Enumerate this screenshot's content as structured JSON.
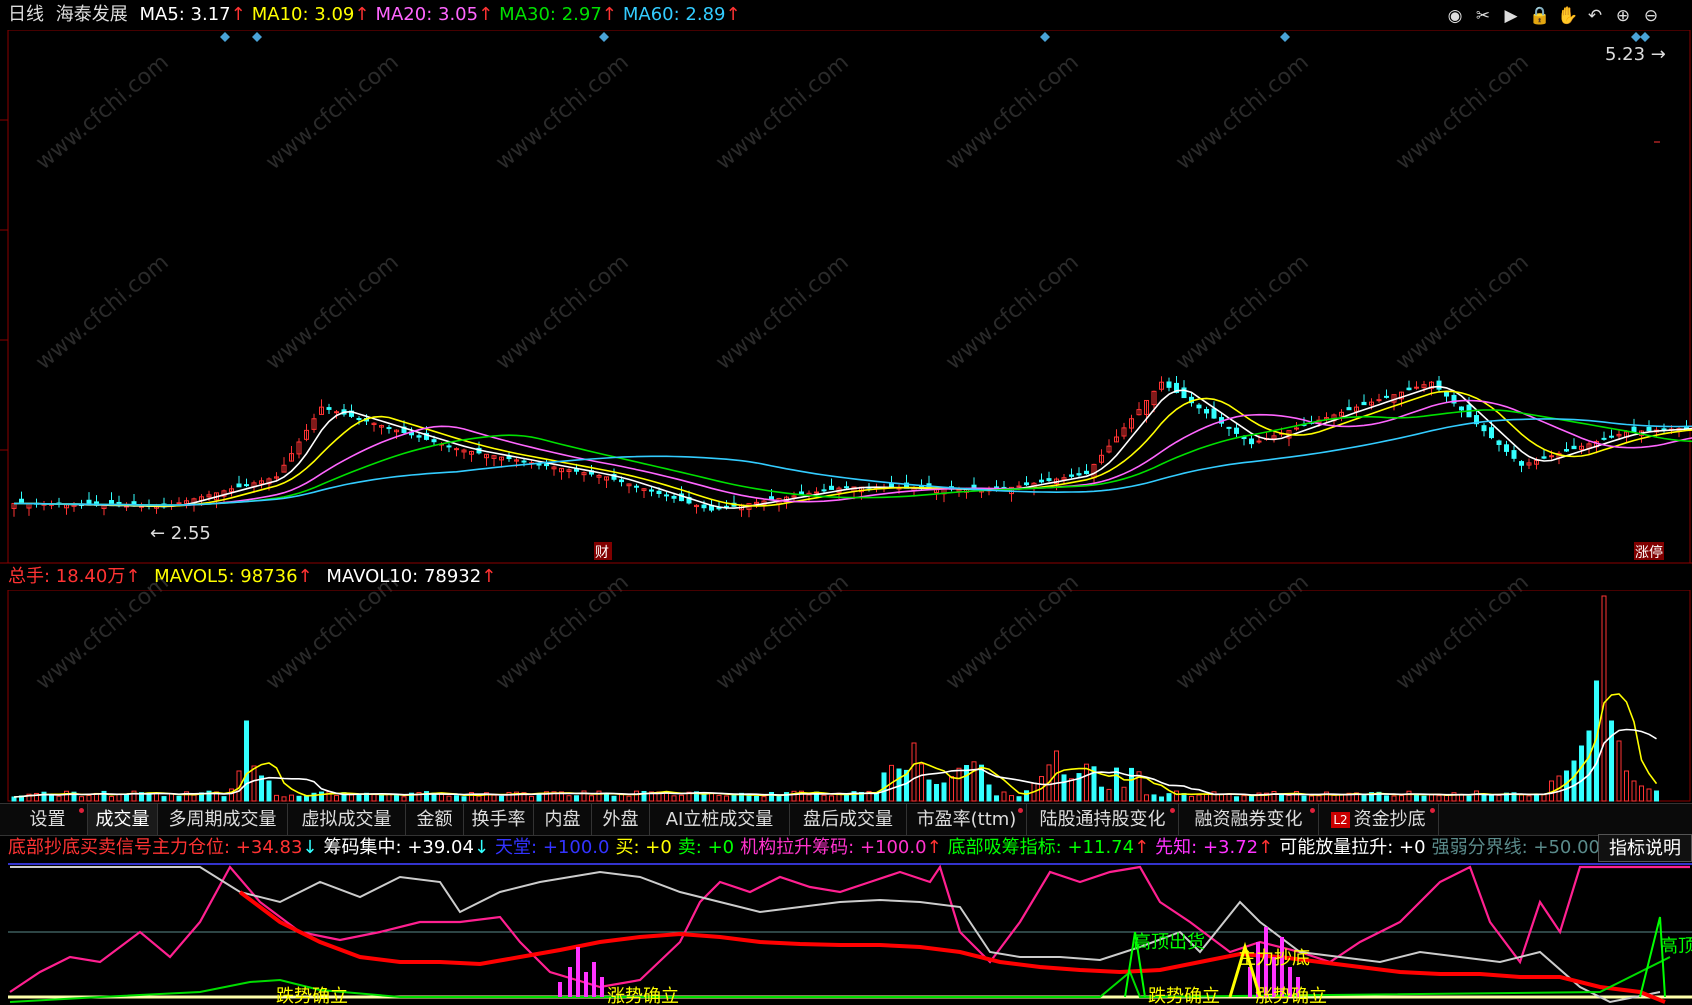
{
  "header": {
    "period": "日线",
    "stock_name": "海泰发展",
    "ma": [
      {
        "label": "MA5: 3.17",
        "arrow": "↑",
        "color": "#ffffff"
      },
      {
        "label": "MA10: 3.09",
        "arrow": "↑",
        "color": "#ffff00"
      },
      {
        "label": "MA20: 3.05",
        "arrow": "↑",
        "color": "#ff66ff"
      },
      {
        "label": "MA30: 2.97",
        "arrow": "↑",
        "color": "#00e000"
      },
      {
        "label": "MA60: 2.89",
        "arrow": "↑",
        "color": "#33ccff"
      }
    ],
    "arrow_color": "#ff3333"
  },
  "toolbar": {
    "icons": [
      "eye-icon",
      "scissors-icon",
      "play-icon",
      "lock-icon",
      "hand-icon",
      "undo-icon",
      "zoom-in-icon",
      "zoom-out-icon"
    ],
    "glyphs": [
      "◉",
      "✂",
      "▶",
      "🔒",
      "✋",
      "↶",
      "⊕",
      "⊖"
    ]
  },
  "price_chart": {
    "high_label": "5.23",
    "low_label": "2.55",
    "marker_cai": "财",
    "marker_limit": "涨停",
    "colors": {
      "up": "#ff3333",
      "down": "#33ffff",
      "ma5": "#ffffff",
      "ma10": "#ffff00",
      "ma20": "#ff66ff",
      "ma30": "#00e000",
      "ma60": "#33ccff"
    }
  },
  "volume": {
    "total_label": "总手: ",
    "total_value": "18.40万",
    "total_arrow": "↑",
    "mavol5_label": "MAVOL5: 98736",
    "mavol5_arrow": "↑",
    "mavol10_label": "MAVOL10: 78932",
    "mavol10_arrow": "↑"
  },
  "tabs": [
    {
      "label": "设置",
      "dot": true
    },
    {
      "label": "成交量",
      "dot": false,
      "active": true
    },
    {
      "label": "多周期成交量",
      "dot": false
    },
    {
      "label": "虚拟成交量",
      "dot": false
    },
    {
      "label": "金额",
      "dot": false
    },
    {
      "label": "换手率",
      "dot": false
    },
    {
      "label": "内盘",
      "dot": false
    },
    {
      "label": "外盘",
      "dot": false
    },
    {
      "label": "AI立桩成交量",
      "dot": false
    },
    {
      "label": "盘后成交量",
      "dot": false
    },
    {
      "label": "市盈率(ttm)",
      "dot": true
    },
    {
      "label": "陆股通持股变化",
      "dot": true
    },
    {
      "label": "融资融券变化",
      "dot": true
    },
    {
      "label": "资金抄底",
      "dot": true,
      "badge": "L2"
    }
  ],
  "indicator": {
    "items": [
      {
        "text": "底部抄底买卖信号",
        "color": "#ff3333"
      },
      {
        "text": "主力仓位: ",
        "color": "#ff3333"
      },
      {
        "text": "+34.83",
        "color": "#ff3333"
      },
      {
        "text": "↓",
        "color": "#33ffff"
      },
      {
        "text": "筹码集中: ",
        "color": "#ffffff"
      },
      {
        "text": "+39.04",
        "color": "#ffffff"
      },
      {
        "text": "↓",
        "color": "#33ffff"
      },
      {
        "text": "天堂: ",
        "color": "#3333ff"
      },
      {
        "text": "+100.0",
        "color": "#3333ff"
      },
      {
        "text": "买: ",
        "color": "#ffff00"
      },
      {
        "text": "+0",
        "color": "#ffff00"
      },
      {
        "text": "卖: ",
        "color": "#00ff00"
      },
      {
        "text": "+0",
        "color": "#00ff00"
      },
      {
        "text": "机构拉升筹码: ",
        "color": "#ff33cc"
      },
      {
        "text": "+100.0",
        "color": "#ff33cc"
      },
      {
        "text": "↑",
        "color": "#ff3333"
      },
      {
        "text": "底部吸筹指标: ",
        "color": "#00ff00"
      },
      {
        "text": "+11.74",
        "color": "#00ff00"
      },
      {
        "text": "↑",
        "color": "#ff3333"
      },
      {
        "text": "先知: ",
        "color": "#ff33ff"
      },
      {
        "text": "+3.72",
        "color": "#ff33ff"
      },
      {
        "text": "↑",
        "color": "#ff3333"
      },
      {
        "text": "可能放量拉升: ",
        "color": "#ffffff"
      },
      {
        "text": "+0",
        "color": "#ffffff"
      },
      {
        "text": "强弱分界线: ",
        "color": "#5a8a8a"
      },
      {
        "text": "+50.00",
        "color": "#5a8a8a"
      }
    ],
    "help_label": "指标说明",
    "annotations": {
      "high_out": "高顶出货",
      "main_bottom": "主力抄底",
      "fall_confirm": "跌势确立",
      "rise_confirm": "涨势确立",
      "high_top": "高顶"
    }
  },
  "watermark": "www.cfchi.com"
}
